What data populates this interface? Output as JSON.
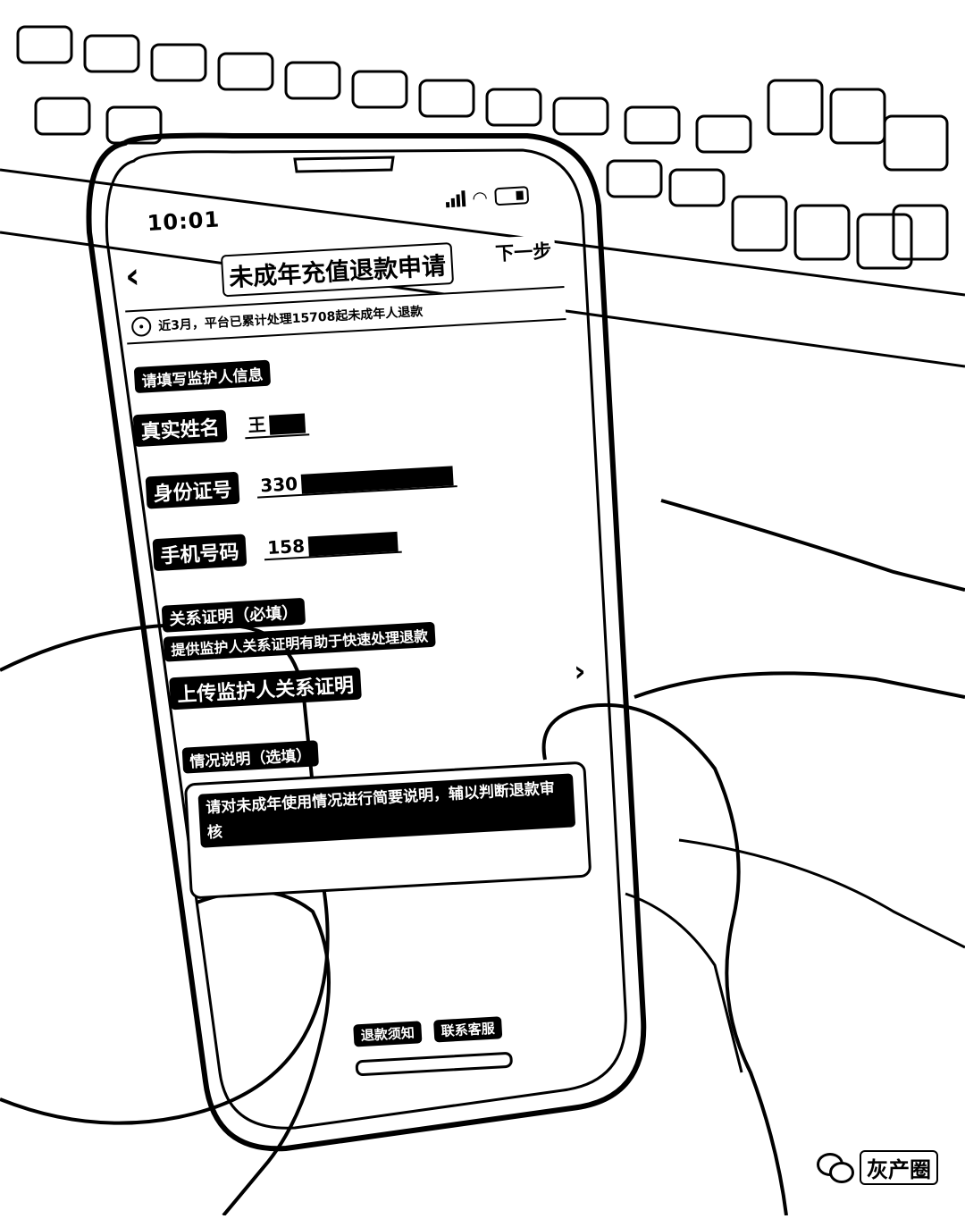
{
  "status_bar": {
    "time": "10:01"
  },
  "header": {
    "back_glyph": "‹",
    "title": "未成年充值退款申请",
    "next_label": "下一步"
  },
  "notice": {
    "text": "近3月，平台已累计处理15708起未成年人退款"
  },
  "guardian_section": {
    "heading": "请填写监护人信息"
  },
  "fields": {
    "name": {
      "label": "真实姓名",
      "value": "王"
    },
    "id_number": {
      "label": "身份证号",
      "value": "330"
    },
    "phone": {
      "label": "手机号码",
      "value": "158"
    }
  },
  "relationship": {
    "title": "关系证明（必填）",
    "hint": "提供监护人关系证明有助于快速处理退款",
    "upload_label": "上传监护人关系证明"
  },
  "description": {
    "title": "情况说明（选填）",
    "placeholder": "请对未成年使用情况进行简要说明，辅以判断退款审核"
  },
  "footer": {
    "refund_notice": "退款须知",
    "contact_support": "联系客服"
  },
  "watermark": {
    "text": "灰产圈"
  },
  "icons": {
    "clock": "clock-icon",
    "chevron": "chevron-right-icon",
    "wechat": "wechat-icon"
  },
  "colors": {
    "ink": "#000000",
    "paper": "#ffffff"
  }
}
